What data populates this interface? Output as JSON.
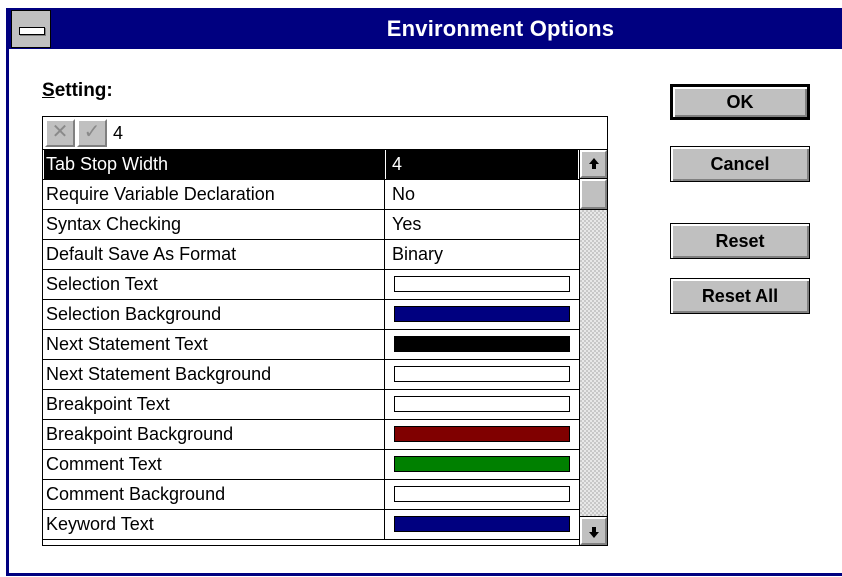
{
  "window": {
    "title": "Environment Options"
  },
  "setting_label": {
    "mnemonic": "S",
    "rest": "etting:"
  },
  "edit_bar": {
    "cancel_glyph": "✕",
    "accept_glyph": "✓",
    "value": "4"
  },
  "settings": [
    {
      "name": "Tab Stop Width",
      "value": "4",
      "selected": true
    },
    {
      "name": "Require Variable Declaration",
      "value": "No"
    },
    {
      "name": "Syntax Checking",
      "value": "Yes"
    },
    {
      "name": "Default Save As Format",
      "value": "Binary"
    },
    {
      "name": "Selection Text",
      "color": "#ffffff"
    },
    {
      "name": "Selection Background",
      "color": "#000080"
    },
    {
      "name": "Next Statement Text",
      "color": "#000000"
    },
    {
      "name": "Next Statement Background",
      "color": "#ffffff"
    },
    {
      "name": "Breakpoint Text",
      "color": "#ffffff"
    },
    {
      "name": "Breakpoint Background",
      "color": "#800000"
    },
    {
      "name": "Comment Text",
      "color": "#008000"
    },
    {
      "name": "Comment Background",
      "color": "#ffffff"
    },
    {
      "name": "Keyword Text",
      "color": "#000080"
    }
  ],
  "buttons": {
    "ok": "OK",
    "cancel": "Cancel",
    "reset": "Reset",
    "reset_all": "Reset All"
  },
  "colors": {
    "title_bar": "#000080",
    "button_face": "#c0c0c0",
    "selection": "#000000"
  }
}
